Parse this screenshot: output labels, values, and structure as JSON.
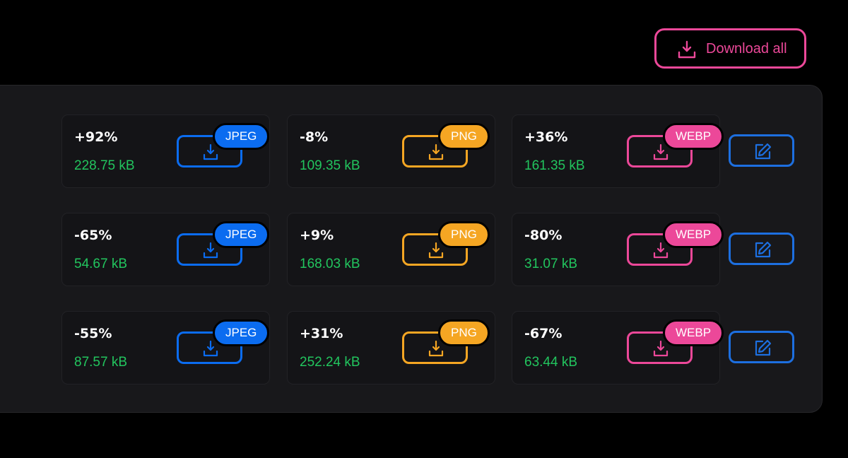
{
  "toolbar": {
    "download_all_label": "Download all",
    "download_all_icon": "download-icon",
    "accent": "#ec4899"
  },
  "formats": {
    "jpeg": {
      "label": "JPEG",
      "color": "#0b6cf0"
    },
    "png": {
      "label": "PNG",
      "color": "#f5a623"
    },
    "webp": {
      "label": "WEBP",
      "color": "#ec4899"
    }
  },
  "colors": {
    "size_text": "#22c55e",
    "edit_button": "#1d6fe0"
  },
  "rows": [
    {
      "jpeg": {
        "change": "+92%",
        "size": "228.75 kB"
      },
      "png": {
        "change": "-8%",
        "size": "109.35 kB"
      },
      "webp": {
        "change": "+36%",
        "size": "161.35 kB"
      },
      "edit_icon": "edit-icon"
    },
    {
      "jpeg": {
        "change": "-65%",
        "size": "54.67 kB"
      },
      "png": {
        "change": "+9%",
        "size": "168.03 kB"
      },
      "webp": {
        "change": "-80%",
        "size": "31.07 kB"
      },
      "edit_icon": "edit-icon"
    },
    {
      "jpeg": {
        "change": "-55%",
        "size": "87.57 kB"
      },
      "png": {
        "change": "+31%",
        "size": "252.24 kB"
      },
      "webp": {
        "change": "-67%",
        "size": "63.44 kB"
      },
      "edit_icon": "edit-icon"
    }
  ]
}
